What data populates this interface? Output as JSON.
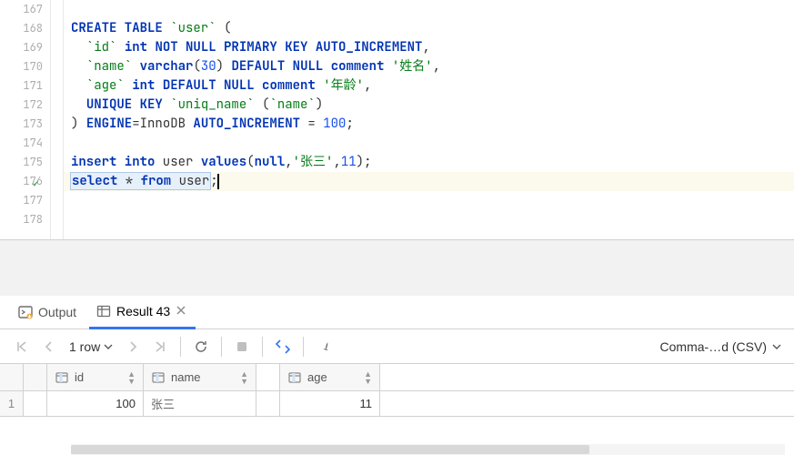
{
  "editor": {
    "line_start": 167,
    "lines": [
      {
        "n": 167,
        "tokens": []
      },
      {
        "n": 168,
        "tokens": [
          {
            "t": "CREATE TABLE ",
            "c": "kw"
          },
          {
            "t": "`user`",
            "c": "bq"
          },
          {
            "t": " (",
            "c": ""
          }
        ]
      },
      {
        "n": 169,
        "tokens": [
          {
            "t": "  ",
            "c": ""
          },
          {
            "t": "`id`",
            "c": "bq"
          },
          {
            "t": " ",
            "c": ""
          },
          {
            "t": "int",
            "c": "kw"
          },
          {
            "t": " ",
            "c": ""
          },
          {
            "t": "NOT NULL PRIMARY KEY AUTO_INCREMENT",
            "c": "kw"
          },
          {
            "t": ",",
            "c": ""
          }
        ]
      },
      {
        "n": 170,
        "tokens": [
          {
            "t": "  ",
            "c": ""
          },
          {
            "t": "`name`",
            "c": "bq"
          },
          {
            "t": " ",
            "c": ""
          },
          {
            "t": "varchar",
            "c": "kw"
          },
          {
            "t": "(",
            "c": ""
          },
          {
            "t": "30",
            "c": "num"
          },
          {
            "t": ") ",
            "c": ""
          },
          {
            "t": "DEFAULT NULL",
            "c": "kw"
          },
          {
            "t": " ",
            "c": ""
          },
          {
            "t": "comment",
            "c": "kw"
          },
          {
            "t": " ",
            "c": ""
          },
          {
            "t": "'姓名'",
            "c": "str"
          },
          {
            "t": ",",
            "c": ""
          }
        ]
      },
      {
        "n": 171,
        "tokens": [
          {
            "t": "  ",
            "c": ""
          },
          {
            "t": "`age`",
            "c": "bq"
          },
          {
            "t": " ",
            "c": ""
          },
          {
            "t": "int",
            "c": "kw"
          },
          {
            "t": " ",
            "c": ""
          },
          {
            "t": "DEFAULT NULL",
            "c": "kw"
          },
          {
            "t": " ",
            "c": ""
          },
          {
            "t": "comment",
            "c": "kw"
          },
          {
            "t": " ",
            "c": ""
          },
          {
            "t": "'年龄'",
            "c": "str"
          },
          {
            "t": ",",
            "c": ""
          }
        ]
      },
      {
        "n": 172,
        "tokens": [
          {
            "t": "  ",
            "c": ""
          },
          {
            "t": "UNIQUE KEY",
            "c": "kw"
          },
          {
            "t": " ",
            "c": ""
          },
          {
            "t": "`uniq_name`",
            "c": "bq"
          },
          {
            "t": " (",
            "c": ""
          },
          {
            "t": "`name`",
            "c": "bq"
          },
          {
            "t": ")",
            "c": ""
          }
        ]
      },
      {
        "n": 173,
        "tokens": [
          {
            "t": ") ",
            "c": ""
          },
          {
            "t": "ENGINE",
            "c": "kw"
          },
          {
            "t": "=InnoDB ",
            "c": ""
          },
          {
            "t": "AUTO_INCREMENT",
            "c": "kw"
          },
          {
            "t": " = ",
            "c": ""
          },
          {
            "t": "100",
            "c": "num"
          },
          {
            "t": ";",
            "c": ""
          }
        ]
      },
      {
        "n": 174,
        "tokens": []
      },
      {
        "n": 175,
        "tokens": [
          {
            "t": "insert into",
            "c": "kw"
          },
          {
            "t": " user ",
            "c": ""
          },
          {
            "t": "values",
            "c": "kw"
          },
          {
            "t": "(",
            "c": ""
          },
          {
            "t": "null",
            "c": "kw"
          },
          {
            "t": ",",
            "c": ""
          },
          {
            "t": "'张三'",
            "c": "str"
          },
          {
            "t": ",",
            "c": ""
          },
          {
            "t": "11",
            "c": "num"
          },
          {
            "t": ");",
            "c": ""
          }
        ]
      },
      {
        "n": 176,
        "tokens": [
          {
            "t": "select * from user",
            "c": "sel"
          },
          {
            "t": ";",
            "c": ""
          }
        ],
        "mark": "check",
        "hl": true,
        "caret": true
      },
      {
        "n": 177,
        "tokens": []
      },
      {
        "n": 178,
        "tokens": []
      }
    ]
  },
  "tabs": {
    "output": {
      "label": "Output"
    },
    "result": {
      "label": "Result 43"
    }
  },
  "toolbar": {
    "row_count": "1 row",
    "export_label": "Comma-…d (CSV)"
  },
  "grid": {
    "columns": [
      {
        "name": "id"
      },
      {
        "name": "name"
      },
      {
        "name": "age"
      }
    ],
    "rows": [
      {
        "n": "1",
        "id": "100",
        "name": "张三",
        "age": "11"
      }
    ]
  }
}
